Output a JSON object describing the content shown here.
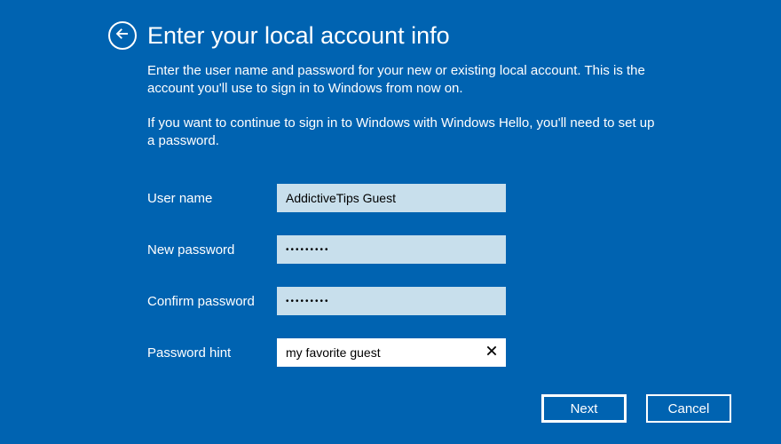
{
  "header": {
    "title": "Enter your local account info"
  },
  "body": {
    "para1": "Enter the user name and password for your new or existing local account. This is the account you'll use to sign in to Windows from now on.",
    "para2": "If you want to continue to sign in to Windows with Windows Hello, you'll need to set up a password."
  },
  "form": {
    "username": {
      "label": "User name",
      "value": "AddictiveTips Guest"
    },
    "new_password": {
      "label": "New password",
      "value": "•••••••••"
    },
    "confirm_password": {
      "label": "Confirm password",
      "value": "•••••••••"
    },
    "hint": {
      "label": "Password hint",
      "value": "my favorite guest"
    }
  },
  "footer": {
    "next": "Next",
    "cancel": "Cancel"
  }
}
